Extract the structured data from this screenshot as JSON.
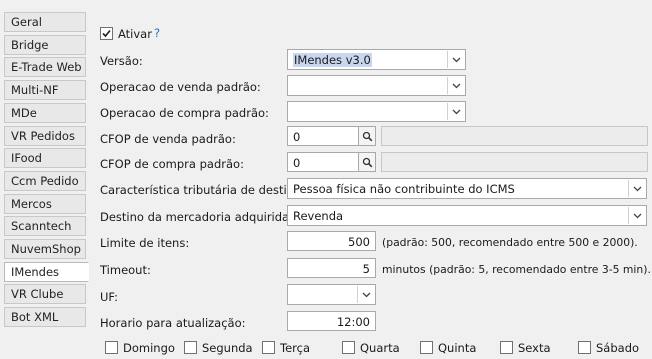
{
  "sidebar": {
    "tabs": [
      "Geral",
      "Bridge",
      "E-Trade Web",
      "Multi-NF",
      "MDe",
      "VR Pedidos",
      "IFood",
      "Ccm Pedido",
      "Mercos",
      "Scanntech",
      "NuvemShop",
      "IMendes",
      "VR Clube",
      "Bot XML"
    ],
    "active_index": 11
  },
  "form": {
    "ativar": {
      "label": "Ativar",
      "checked": true,
      "help": "?"
    },
    "versao": {
      "label": "Versão:",
      "value": "IMendes v3.0"
    },
    "op_venda": {
      "label": "Operacao de venda padrão:",
      "value": ""
    },
    "op_compra": {
      "label": "Operacao de compra padrão:",
      "value": ""
    },
    "cfop_venda": {
      "label": "CFOP de venda padrão:",
      "value": "0",
      "description": ""
    },
    "cfop_compra": {
      "label": "CFOP de compra padrão:",
      "value": "0",
      "description": ""
    },
    "caracteristica": {
      "label": "Característica tributária de destino:",
      "value": "Pessoa física não contribuinte do ICMS"
    },
    "destino": {
      "label": "Destino da mercadoria adquirida:",
      "value": "Revenda"
    },
    "limite": {
      "label": "Limite de itens:",
      "value": "500",
      "hint": "(padrão: 500, recomendado entre 500 e 2000)."
    },
    "timeout": {
      "label": "Timeout:",
      "value": "5",
      "hint": "minutos (padrão: 5, recomendado entre 3-5 min)."
    },
    "uf": {
      "label": "UF:",
      "value": ""
    },
    "horario": {
      "label": "Horario para atualização:",
      "value": "12:00"
    },
    "dias": [
      "Domingo",
      "Segunda",
      "Terça",
      "Quarta",
      "Quinta",
      "Sexta",
      "Sábado"
    ]
  },
  "colors": {
    "accent": "#2b6cc4",
    "selection": "#c8d6ee"
  }
}
